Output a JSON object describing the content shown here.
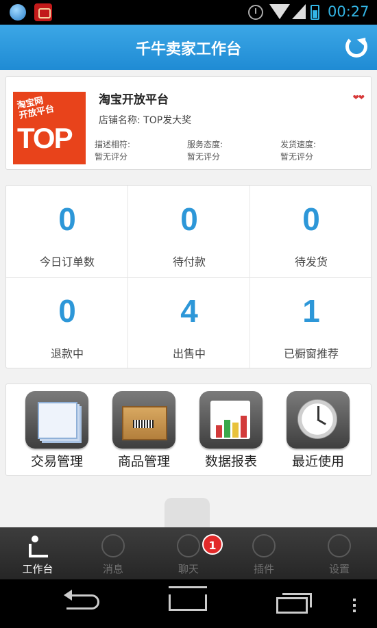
{
  "status_bar": {
    "time": "00:27"
  },
  "header": {
    "title": "千牛卖家工作台"
  },
  "shop": {
    "name": "淘宝开放平台",
    "store_label": "店铺名称: TOP发大奖",
    "logo_text_small": "淘宝网\n开放平台",
    "logo_text_big": "TOP",
    "ratings": [
      {
        "label": "描述相符:",
        "value": "暂无评分"
      },
      {
        "label": "服务态度:",
        "value": "暂无评分"
      },
      {
        "label": "发货速度:",
        "value": "暂无评分"
      }
    ],
    "hearts": "❤❤"
  },
  "stats": [
    {
      "value": "0",
      "label": "今日订单数"
    },
    {
      "value": "0",
      "label": "待付款"
    },
    {
      "value": "0",
      "label": "待发货"
    },
    {
      "value": "0",
      "label": "退款中"
    },
    {
      "value": "4",
      "label": "出售中"
    },
    {
      "value": "1",
      "label": "已橱窗推荐"
    }
  ],
  "apps": [
    {
      "label": "交易管理",
      "icon": "trade-icon"
    },
    {
      "label": "商品管理",
      "icon": "goods-icon"
    },
    {
      "label": "数据报表",
      "icon": "data-report-icon"
    },
    {
      "label": "最近使用",
      "icon": "clock-icon"
    }
  ],
  "tabs": [
    {
      "label": "工作台",
      "icon": "workbench-icon",
      "active": true
    },
    {
      "label": "消息",
      "icon": "message-icon"
    },
    {
      "label": "聊天",
      "icon": "chat-icon",
      "badge": "1"
    },
    {
      "label": "插件",
      "icon": "plugin-icon"
    },
    {
      "label": "设置",
      "icon": "settings-icon"
    }
  ],
  "colors": {
    "accent": "#2d97d8",
    "header": "#1f8bd4",
    "badge": "#e22a2a",
    "logo": "#e8431b"
  }
}
